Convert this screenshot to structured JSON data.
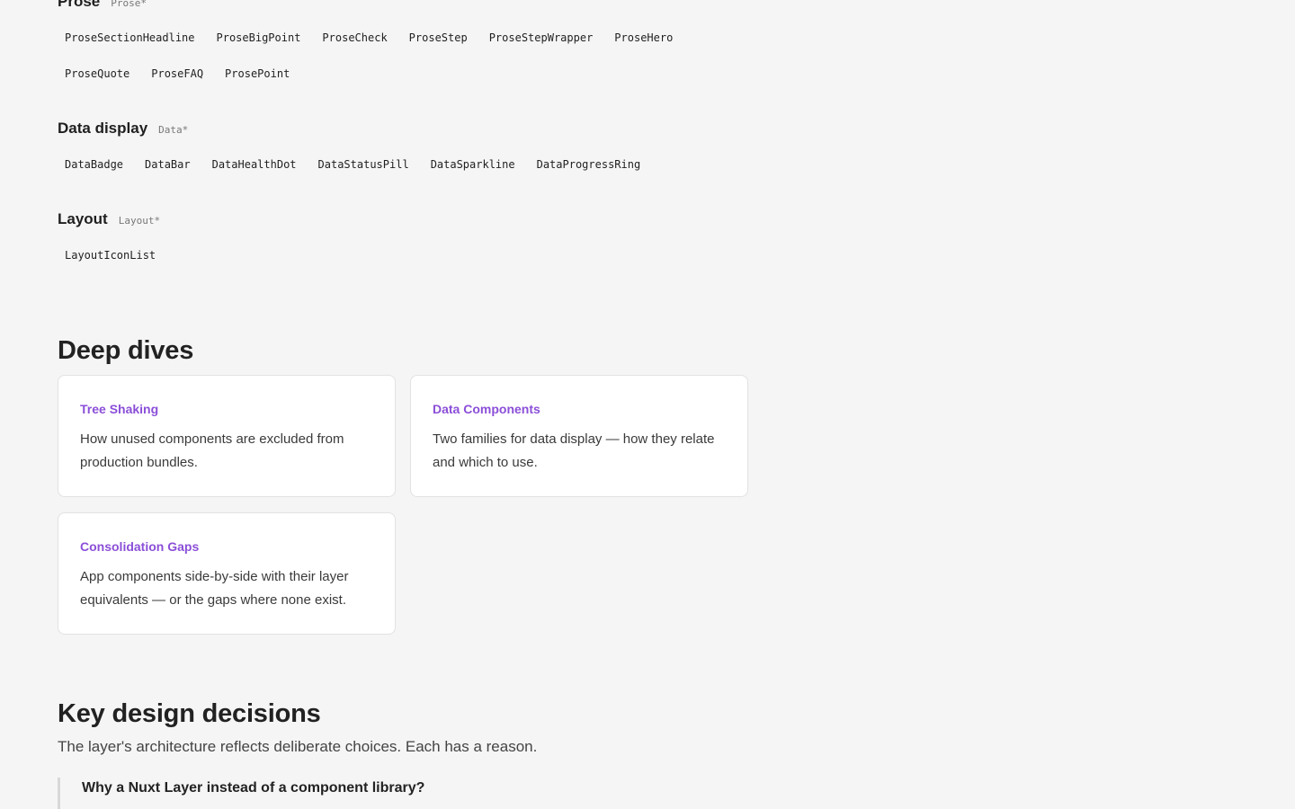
{
  "groups": [
    {
      "title": "Prose",
      "prefix": "Prose*",
      "items": [
        "ProseSectionHeadline",
        "ProseBigPoint",
        "ProseCheck",
        "ProseStep",
        "ProseStepWrapper",
        "ProseHero",
        "ProseQuote",
        "ProseFAQ",
        "ProsePoint"
      ]
    },
    {
      "title": "Data display",
      "prefix": "Data*",
      "items": [
        "DataBadge",
        "DataBar",
        "DataHealthDot",
        "DataStatusPill",
        "DataSparkline",
        "DataProgressRing"
      ]
    },
    {
      "title": "Layout",
      "prefix": "Layout*",
      "items": [
        "LayoutIconList"
      ]
    }
  ],
  "deep_dives": {
    "title": "Deep dives",
    "cards": [
      {
        "title": "Tree Shaking",
        "desc": "How unused components are excluded from production bundles."
      },
      {
        "title": "Data Components",
        "desc": "Two families for data display — how they relate and which to use."
      },
      {
        "title": "Consolidation Gaps",
        "desc": "App components side-by-side with their layer equivalents — or the gaps where none exist."
      }
    ]
  },
  "design_decisions": {
    "title": "Key design decisions",
    "lead": "The layer's architecture reflects deliberate choices. Each has a reason.",
    "faq": [
      {
        "question": "Why a Nuxt Layer instead of a component library?"
      }
    ]
  },
  "colors": {
    "background": "#f5f5f5",
    "card_title": "#8b4fd8",
    "card_bg": "#ffffff"
  }
}
